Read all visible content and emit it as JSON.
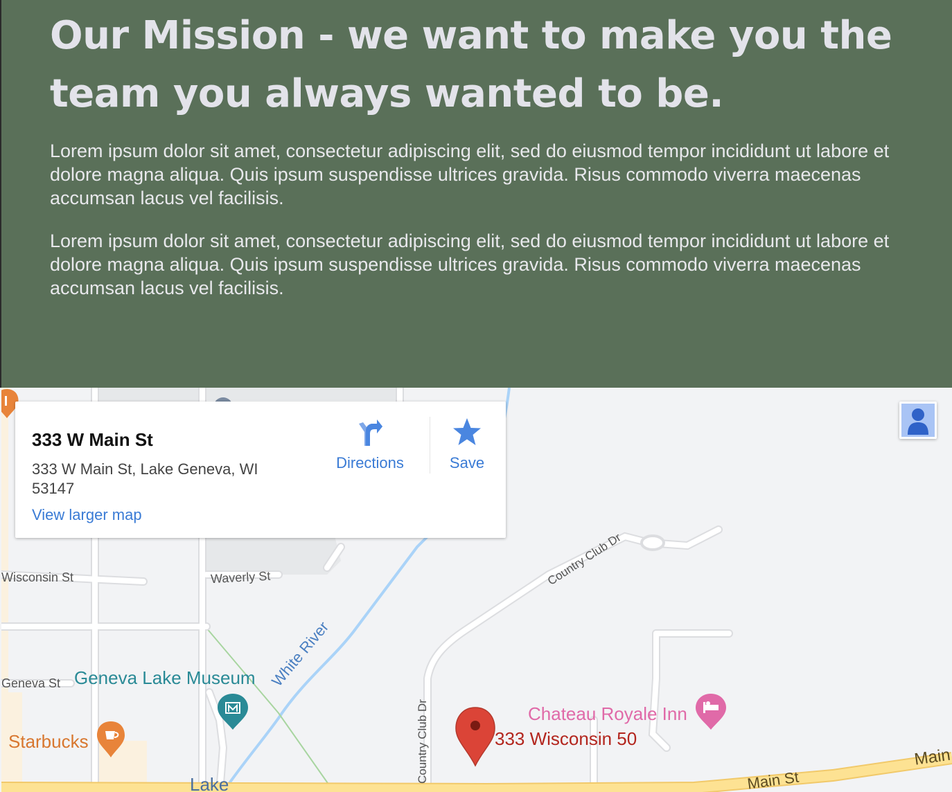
{
  "mission": {
    "heading": "Our Mission - we want to make you the team you always wanted to be.",
    "paragraphs": [
      "Lorem ipsum dolor sit amet, consectetur adipiscing elit, sed do eiusmod tempor incididunt ut labore et dolore magna aliqua. Quis ipsum suspendisse ultrices gravida. Risus commodo viverra maecenas accumsan lacus vel facilisis.",
      "Lorem ipsum dolor sit amet, consectetur adipiscing elit, sed do eiusmod tempor incididunt ut labore et dolore magna aliqua. Quis ipsum suspendisse ultrices gravida. Risus commodo viverra maecenas accumsan lacus vel facilisis."
    ]
  },
  "map": {
    "info_card": {
      "title": "333 W Main St",
      "address": "333 W Main St, Lake Geneva, WI 53147",
      "directions_label": "Directions",
      "save_label": "Save",
      "larger_map_label": "View larger map"
    },
    "labels": {
      "country_club_dr": "Country Club Dr",
      "country_club_dr_vertical": "Country Club Dr",
      "wisconsin_st": "Wisconsin St",
      "waverly_st": "Waverly St",
      "geneva_st": "Geneva St",
      "geneva_lake_museum": "Geneva Lake Museum",
      "white_river": "White River",
      "chateau_royale_inn": "Chateau Royale Inn",
      "marker_label": "333 Wisconsin 50",
      "starbucks": "Starbucks",
      "lake": "Lake",
      "main_st": "Main St",
      "main_st_right": "Main"
    },
    "colors": {
      "mission_bg": "#5a7059",
      "link_blue": "#3a7bd5",
      "marker_red": "#db4437",
      "museum_teal": "#2a8a96",
      "hotel_pink": "#e06aa8",
      "cafe_orange": "#e8843a",
      "river_blue": "#aad3f8",
      "highway_yellow": "#fde293"
    },
    "icons": [
      "directions-icon",
      "star-icon",
      "pegman-icon",
      "museum-icon",
      "hotel-icon",
      "cafe-icon",
      "restaurant-icon",
      "map-marker-icon"
    ]
  }
}
